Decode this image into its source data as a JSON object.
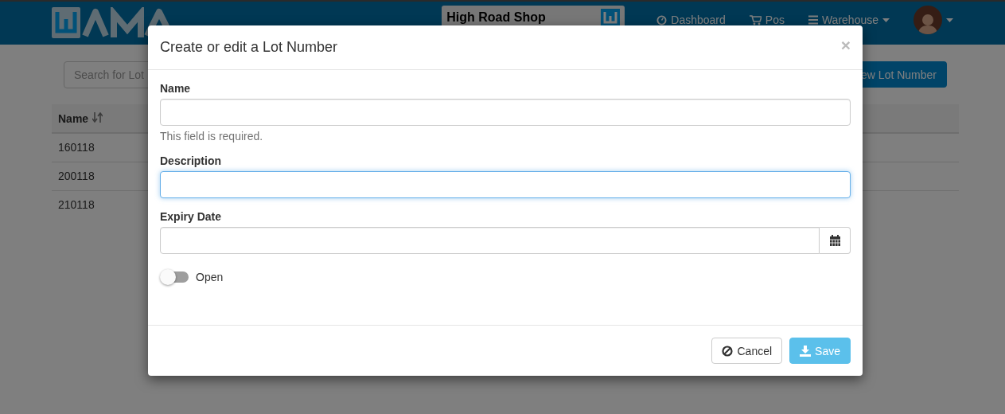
{
  "navbar": {
    "shop_select": "High Road Shop",
    "links": [
      {
        "label": "Dashboard",
        "dropdown": false
      },
      {
        "label": "Pos",
        "dropdown": false
      },
      {
        "label": "Warehouse",
        "dropdown": true
      }
    ]
  },
  "search": {
    "placeholder": "Search for Lot"
  },
  "new_button": "ew Lot Number",
  "table": {
    "columns": [
      {
        "label": "Name",
        "sortable": true
      }
    ],
    "rows": [
      [
        "160118"
      ],
      [
        "200118"
      ],
      [
        "210118"
      ]
    ]
  },
  "modal": {
    "title": "Create or edit a Lot Number",
    "close": "×",
    "fields": [
      {
        "kind": "text",
        "label": "Name",
        "focused": false,
        "help": "This field is required."
      },
      {
        "kind": "text",
        "label": "Description",
        "focused": true
      },
      {
        "kind": "date",
        "label": "Expiry Date",
        "focused": false
      }
    ],
    "toggle": {
      "label": "Open",
      "on": false
    },
    "buttons": [
      {
        "kind": "cancel",
        "label": "Cancel",
        "disabled": false
      },
      {
        "kind": "save",
        "label": "Save",
        "disabled": true
      }
    ]
  }
}
